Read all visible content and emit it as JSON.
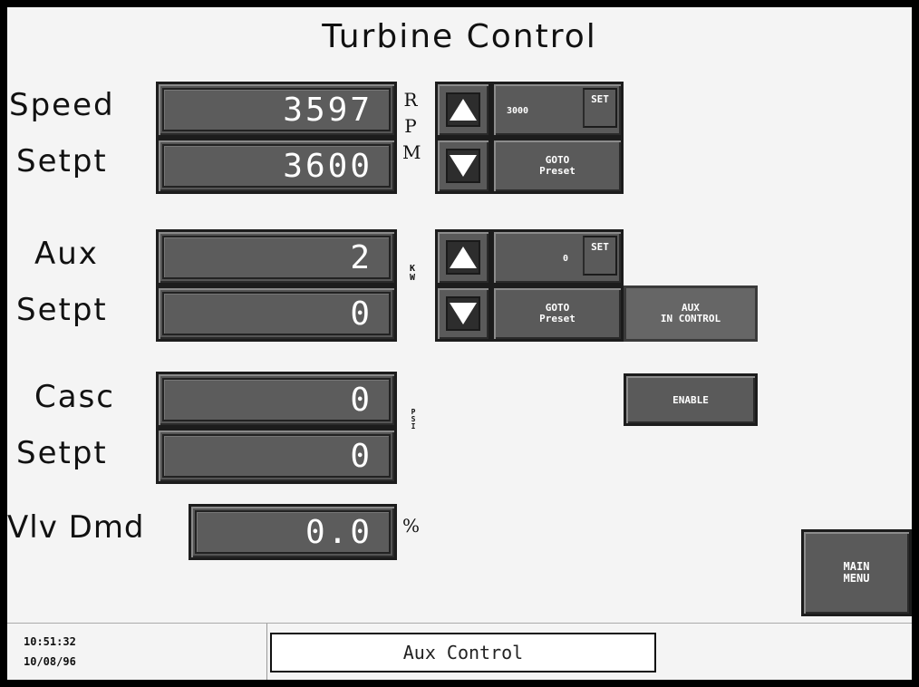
{
  "title": "Turbine Control",
  "speed": {
    "label": "Speed",
    "value": "3597",
    "setpt_label": "Setpt",
    "setpt_value": "3600",
    "unit_letters": [
      "R",
      "P",
      "M"
    ],
    "preset_value": "3000",
    "set_label": "SET",
    "goto_line1": "GOTO",
    "goto_line2": "Preset"
  },
  "aux": {
    "label": "Aux",
    "value": "2",
    "setpt_label": "Setpt",
    "setpt_value": "0",
    "unit_letters": [
      "K",
      "W"
    ],
    "preset_value": "0",
    "set_label": "SET",
    "goto_line1": "GOTO",
    "goto_line2": "Preset",
    "in_control_line1": "AUX",
    "in_control_line2": "IN CONTROL"
  },
  "casc": {
    "label": "Casc",
    "value": "0",
    "setpt_label": "Setpt",
    "setpt_value": "0",
    "unit_letters": [
      "P",
      "S",
      "I"
    ],
    "enable_label": "ENABLE"
  },
  "valve": {
    "label": "Vlv Dmd",
    "value": "0.0",
    "unit": "%"
  },
  "main_menu": {
    "line1": "MAIN",
    "line2": "MENU"
  },
  "footer": {
    "time": "10:51:32",
    "date": "10/08/96",
    "status": "Aux Control"
  },
  "icons": {
    "up": "up-arrow-icon",
    "down": "down-arrow-icon"
  }
}
